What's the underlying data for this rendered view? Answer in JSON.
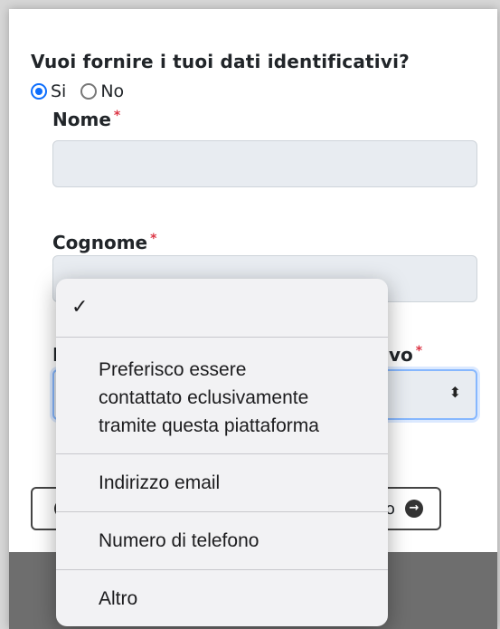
{
  "form": {
    "question": "Vuoi fornire i tuoi dati identificativi?",
    "radio_options": [
      {
        "label": "Si",
        "selected": true
      },
      {
        "label": "No",
        "selected": false
      }
    ],
    "fields": {
      "nome": {
        "label": "Nome",
        "required_mark": "*"
      },
      "cognome": {
        "label": "Cognome",
        "required_mark": "*"
      },
      "contact": {
        "label_fragment_start": "I",
        "label_fragment_end": "vo",
        "required_mark": "*",
        "select_arrows": "⬍"
      }
    },
    "buttons": {
      "back_icon": "<",
      "next_fragment": "o",
      "next_icon": "→"
    }
  },
  "dropdown": {
    "selected_checkmark": "✓",
    "options": [
      {
        "lines": [
          "Preferisco essere",
          "contattato eclusivamente",
          "tramite questa piattaforma"
        ]
      },
      {
        "lines": [
          "Indirizzo email"
        ]
      },
      {
        "lines": [
          "Numero di telefono"
        ]
      },
      {
        "lines": [
          "Altro"
        ]
      }
    ]
  },
  "colors": {
    "accent": "#0d6efd",
    "required": "#dc3545",
    "footer": "#6e6e6e"
  }
}
